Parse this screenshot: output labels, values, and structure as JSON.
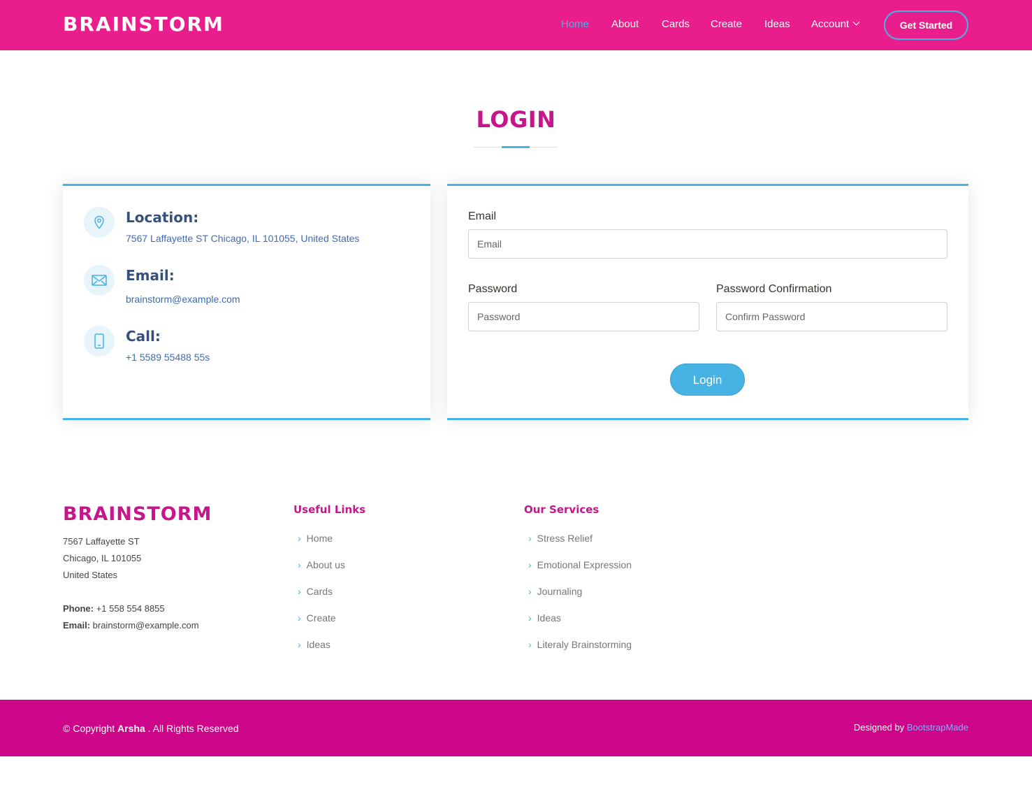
{
  "header": {
    "logo": "BRAINSTORM",
    "nav": [
      {
        "label": "Home",
        "active": true
      },
      {
        "label": "About",
        "active": false
      },
      {
        "label": "Cards",
        "active": false
      },
      {
        "label": "Create",
        "active": false
      },
      {
        "label": "Ideas",
        "active": false
      },
      {
        "label": "Account",
        "active": false
      }
    ],
    "cta": "Get Started"
  },
  "section": {
    "title": "LOGIN"
  },
  "info": {
    "location_heading": "Location:",
    "location_text": "7567 Laffayette ST Chicago, IL 101055, United States",
    "email_heading": "Email:",
    "email_text": "brainstorm@example.com",
    "call_heading": "Call:",
    "call_text": "+1 5589 55488 55s",
    "icons": [
      "map-pin-icon",
      "envelope-icon",
      "phone-icon"
    ]
  },
  "form": {
    "email_label": "Email",
    "email_placeholder": "Email",
    "password_label": "Password",
    "password_placeholder": "Password",
    "confirm_label": "Password Confirmation",
    "confirm_placeholder": "Confirm Password",
    "submit": "Login"
  },
  "footer": {
    "logo": "BRAINSTORM",
    "address_line1": "7567 Laffayette ST",
    "address_line2": "Chicago, IL 101055",
    "address_line3": "United States",
    "phone_label": "Phone:",
    "phone_value": "+1 558 554 8855",
    "email_label": "Email:",
    "email_value": "brainstorm@example.com",
    "useful_links_title": "Useful Links",
    "useful_links": [
      "Home",
      "About us",
      "Cards",
      "Create",
      "Ideas"
    ],
    "services_title": "Our Services",
    "services": [
      "Stress Relief",
      "Emotional Expression",
      "Journaling",
      "Ideas",
      "Literaly Brainstorming"
    ],
    "copyright_prefix": "© Copyright",
    "copyright_brand": "Arsha",
    "copyright_suffix": ". All Rights Reserved",
    "credits_prefix": "Designed by",
    "credits_link": "BootstrapMade"
  },
  "colors": {
    "header_bg": "#e91e8c",
    "accent_blue": "#47b2e4",
    "brand_magenta": "#c7158b",
    "footer_bottom_bg": "#cd0588",
    "heading_navy": "#37517e"
  }
}
